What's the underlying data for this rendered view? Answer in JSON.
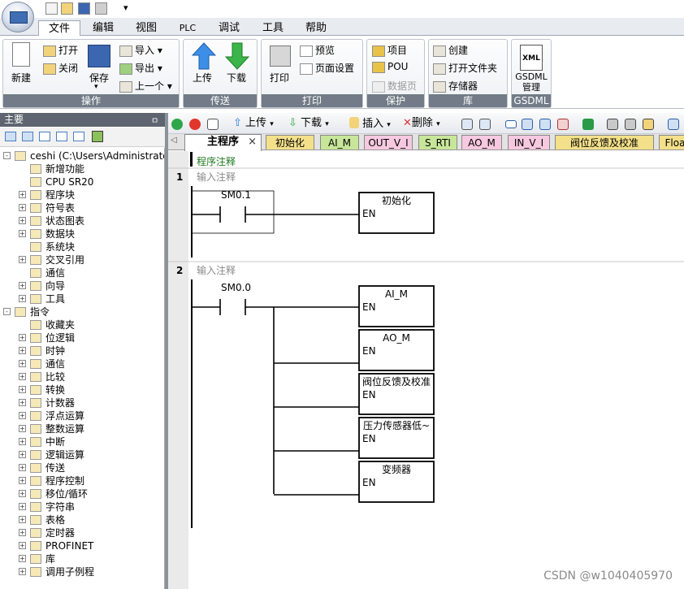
{
  "quick_access": {
    "dropdown": "▾"
  },
  "menu_tabs": [
    "文件",
    "编辑",
    "视图",
    "PLC",
    "调试",
    "工具",
    "帮助"
  ],
  "ribbon": {
    "groups": [
      {
        "name": "操作",
        "items": [
          "新建",
          "打开",
          "关闭",
          "保存",
          "导入",
          "导出",
          "上一个"
        ]
      },
      {
        "name": "传送",
        "items": [
          "上传",
          "下载"
        ]
      },
      {
        "name": "打印",
        "items": [
          "打印",
          "预览",
          "页面设置"
        ]
      },
      {
        "name": "保护",
        "items": [
          "项目",
          "POU",
          "数据页"
        ]
      },
      {
        "name": "库",
        "items": [
          "创建",
          "打开文件夹",
          "存储器"
        ]
      },
      {
        "name": "GSDML",
        "items": [
          "GSDML\n管理"
        ],
        "icon_text": "XML"
      }
    ]
  },
  "left_panel": {
    "title": "主要",
    "pin": "ㅁ",
    "tree": [
      {
        "label": "ceshi (C:\\Users\\Administrator\\De",
        "level": 0,
        "exp": "-"
      },
      {
        "label": "新增功能",
        "level": 1,
        "exp": ""
      },
      {
        "label": "CPU SR20",
        "level": 1,
        "exp": ""
      },
      {
        "label": "程序块",
        "level": 1,
        "exp": "+"
      },
      {
        "label": "符号表",
        "level": 1,
        "exp": "+"
      },
      {
        "label": "状态图表",
        "level": 1,
        "exp": "+"
      },
      {
        "label": "数据块",
        "level": 1,
        "exp": "+"
      },
      {
        "label": "系统块",
        "level": 1,
        "exp": ""
      },
      {
        "label": "交叉引用",
        "level": 1,
        "exp": "+"
      },
      {
        "label": "通信",
        "level": 1,
        "exp": ""
      },
      {
        "label": "向导",
        "level": 1,
        "exp": "+"
      },
      {
        "label": "工具",
        "level": 1,
        "exp": "+"
      },
      {
        "label": "指令",
        "level": 0,
        "exp": "-"
      },
      {
        "label": "收藏夹",
        "level": 1,
        "exp": ""
      },
      {
        "label": "位逻辑",
        "level": 1,
        "exp": "+"
      },
      {
        "label": "时钟",
        "level": 1,
        "exp": "+"
      },
      {
        "label": "通信",
        "level": 1,
        "exp": "+"
      },
      {
        "label": "比较",
        "level": 1,
        "exp": "+"
      },
      {
        "label": "转换",
        "level": 1,
        "exp": "+"
      },
      {
        "label": "计数器",
        "level": 1,
        "exp": "+"
      },
      {
        "label": "浮点运算",
        "level": 1,
        "exp": "+"
      },
      {
        "label": "整数运算",
        "level": 1,
        "exp": "+"
      },
      {
        "label": "中断",
        "level": 1,
        "exp": "+"
      },
      {
        "label": "逻辑运算",
        "level": 1,
        "exp": "+"
      },
      {
        "label": "传送",
        "level": 1,
        "exp": "+"
      },
      {
        "label": "程序控制",
        "level": 1,
        "exp": "+"
      },
      {
        "label": "移位/循环",
        "level": 1,
        "exp": "+"
      },
      {
        "label": "字符串",
        "level": 1,
        "exp": "+"
      },
      {
        "label": "表格",
        "level": 1,
        "exp": "+"
      },
      {
        "label": "定时器",
        "level": 1,
        "exp": "+"
      },
      {
        "label": "PROFINET",
        "level": 1,
        "exp": "+"
      },
      {
        "label": "库",
        "level": 1,
        "exp": "+"
      },
      {
        "label": "调用子例程",
        "level": 1,
        "exp": "+"
      }
    ]
  },
  "editor_toolbar": {
    "upload": "上传",
    "download": "下载",
    "insert": "插入",
    "delete": "删除"
  },
  "pou_tabs": [
    {
      "label": "主程序",
      "active": true,
      "color": "#ffffff"
    },
    {
      "label": "初始化",
      "color": "#f3e08a"
    },
    {
      "label": "AI_M",
      "color": "#c8e69a"
    },
    {
      "label": "OUT_V_I",
      "color": "#f6c9e0"
    },
    {
      "label": "S_RTI",
      "color": "#c8e69a"
    },
    {
      "label": "AO_M",
      "color": "#f6c9e0"
    },
    {
      "label": "IN_V_I",
      "color": "#f6c9e0"
    },
    {
      "label": "阀位反馈及校准",
      "color": "#f3e08a"
    },
    {
      "label": "Floa",
      "color": "#f3e08a"
    }
  ],
  "program_comment": "程序注释",
  "networks": [
    {
      "number": "1",
      "comment": "输入注释",
      "contact": "SM0.1",
      "boxes": [
        {
          "name": "初始化",
          "pin": "EN"
        }
      ]
    },
    {
      "number": "2",
      "comment": "输入注释",
      "contact": "SM0.0",
      "boxes": [
        {
          "name": "AI_M",
          "pin": "EN"
        },
        {
          "name": "AO_M",
          "pin": "EN"
        },
        {
          "name": "阀位反馈及校准",
          "pin": "EN"
        },
        {
          "name": "压力传感器低~",
          "pin": "EN"
        },
        {
          "name": "变频器",
          "pin": "EN"
        }
      ]
    }
  ],
  "watermark": "CSDN @w1040405970"
}
